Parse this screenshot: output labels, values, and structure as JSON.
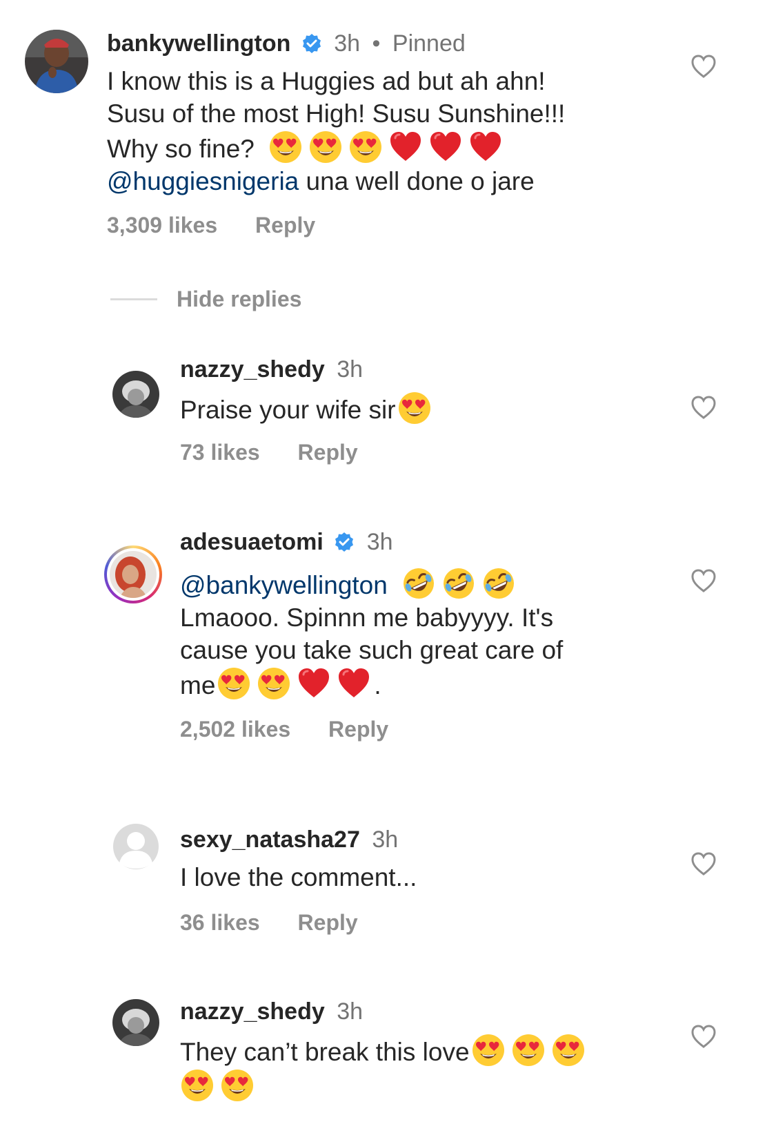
{
  "colors": {
    "text": "#262626",
    "secondary": "#737373",
    "meta": "#8e8e8e",
    "mention": "#00376b",
    "verified_badge": "#3897f0",
    "divider": "#dbdbdb"
  },
  "comment_main": {
    "username": "bankywellington",
    "verified": true,
    "time": "3h",
    "dot": "•",
    "pinned": "Pinned",
    "text_line1": "I know this is a Huggies ad but ah ahn!",
    "text_line2": "Susu of the most High! Susu Sunshine!!!",
    "text_line3": "Why so fine?",
    "mention": "@huggiesnigeria",
    "text_line4_rest": " una well done o jare",
    "likes": "3,309 likes",
    "reply": "Reply",
    "icons": [
      "heart-eyes-emoji",
      "heart-eyes-emoji",
      "heart-eyes-emoji",
      "red-heart-emoji",
      "red-heart-emoji",
      "red-heart-emoji"
    ]
  },
  "hide_replies": "Hide replies",
  "reply1": {
    "username": "nazzy_shedy",
    "time": "3h",
    "text": "Praise your wife sir",
    "likes": "73 likes",
    "reply": "Reply"
  },
  "reply2": {
    "username": "adesuaetomi",
    "verified": true,
    "time": "3h",
    "mention": "@bankywellington",
    "text_line2": "Lmaooo. Spinnn me babyyyy. It's",
    "text_line3": "cause you take such great care of",
    "text_line4": "me",
    "text_end": ".",
    "likes": "2,502 likes",
    "reply": "Reply"
  },
  "reply3": {
    "username": "sexy_natasha27",
    "time": "3h",
    "text": "I love the comment...",
    "likes": "36 likes",
    "reply": "Reply"
  },
  "reply4": {
    "username": "nazzy_shedy",
    "time": "3h",
    "text": "They can’t break this love"
  }
}
